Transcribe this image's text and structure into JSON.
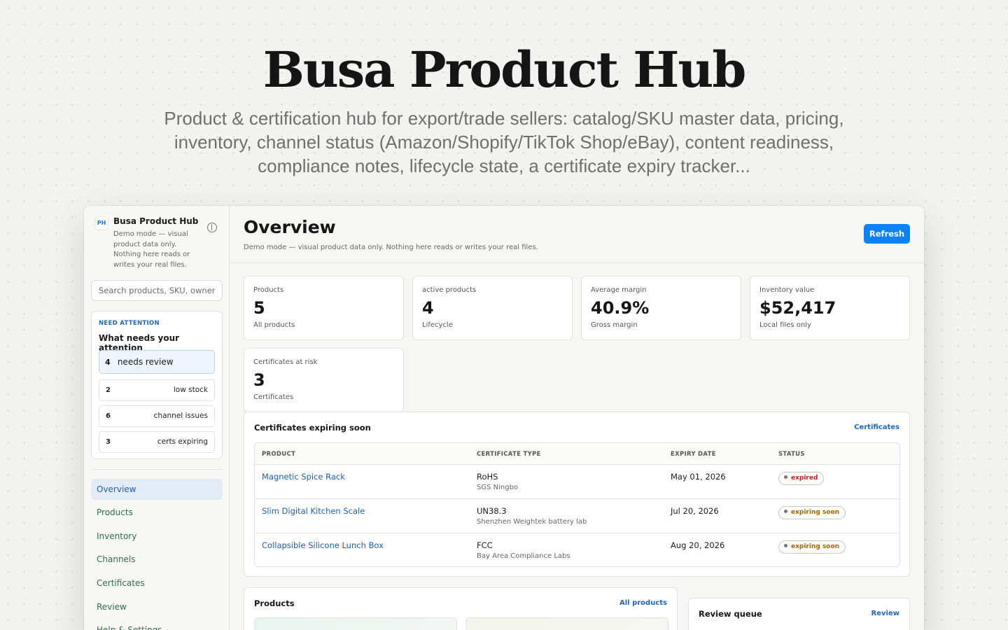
{
  "hero": {
    "title": "Busa Product Hub",
    "description": "Product & certification hub for export/trade sellers: catalog/SKU master data, pricing, inventory, channel status (Amazon/Shopify/TikTok Shop/eBay), content readiness, compliance notes, lifecycle state, a certificate expiry tracker..."
  },
  "sidebar": {
    "logo_text": "PH",
    "app_name": "Busa Product Hub",
    "description": "Demo mode — visual product data only. Nothing here reads or writes your real files.",
    "search_placeholder": "Search products, SKU, owner...",
    "attention": {
      "kicker": "NEED ATTENTION",
      "title": "What needs your attention",
      "primary": {
        "count": "4",
        "label": "needs review"
      },
      "items": [
        {
          "count": "2",
          "label": "low stock"
        },
        {
          "count": "6",
          "label": "channel issues"
        },
        {
          "count": "3",
          "label": "certs expiring"
        }
      ]
    },
    "nav": [
      "Overview",
      "Products",
      "Inventory",
      "Channels",
      "Certificates",
      "Review",
      "Help & Settings"
    ]
  },
  "header": {
    "title": "Overview",
    "subtitle": "Demo mode — visual product data only. Nothing here reads or writes your real files.",
    "refresh_label": "Refresh"
  },
  "stats": [
    {
      "label": "Products",
      "value": "5",
      "caption": "All products"
    },
    {
      "label": "active products",
      "value": "4",
      "caption": "Lifecycle"
    },
    {
      "label": "Average margin",
      "value": "40.9%",
      "caption": "Gross margin"
    },
    {
      "label": "Inventory value",
      "value": "$52,417",
      "caption": "Local files only"
    },
    {
      "label": "Certificates at risk",
      "value": "3",
      "caption": "Certificates"
    }
  ],
  "certificates": {
    "title": "Certificates expiring soon",
    "link": "Certificates",
    "columns": [
      "PRODUCT",
      "CERTIFICATE TYPE",
      "EXPIRY DATE",
      "STATUS"
    ],
    "rows": [
      {
        "product": "Magnetic Spice Rack",
        "type": "RoHS",
        "lab": "SGS Ningbo",
        "expiry": "May 01, 2026",
        "status": "expired",
        "status_color": "#c0212b"
      },
      {
        "product": "Slim Digital Kitchen Scale",
        "type": "UN38.3",
        "lab": "Shenzhen Weightek battery lab",
        "expiry": "Jul 20, 2026",
        "status": "expiring soon",
        "status_color": "#a56a06"
      },
      {
        "product": "Collapsible Silicone Lunch Box",
        "type": "FCC",
        "lab": "Bay Area Compliance Labs",
        "expiry": "Aug 20, 2026",
        "status": "expiring soon",
        "status_color": "#a56a06"
      }
    ]
  },
  "products_panel": {
    "title": "Products",
    "link": "All products"
  },
  "review_panel": {
    "title": "Review queue",
    "link": "Review"
  },
  "colors": {
    "accent": "#0d82f6",
    "link": "#1e5fae",
    "nav": "#2f6e4e"
  }
}
